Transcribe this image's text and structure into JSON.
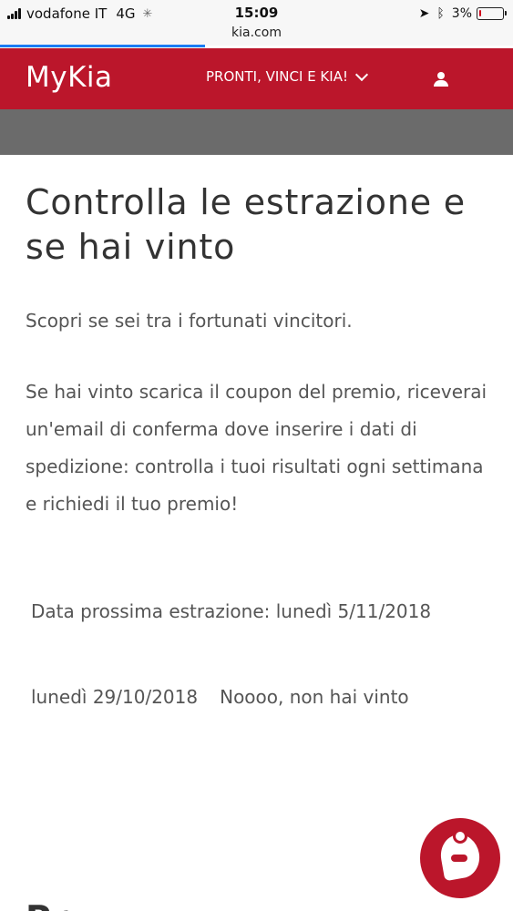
{
  "status_bar": {
    "carrier": "vodafone IT",
    "network": "4G",
    "time": "15:09",
    "battery": "3%",
    "battery_level": 0.03,
    "url": "kia.com",
    "page_load_progress": 0.4
  },
  "header": {
    "logo": "MyKia",
    "campaign_menu": "PRONTI, VINCI E KIA!",
    "icons": [
      "chevron-down-icon",
      "user-icon"
    ],
    "brand_color": "#bb162b"
  },
  "main": {
    "title": "Controlla le estrazione e se hai vinto",
    "intro": "Scopri se sei tra i fortunati vincitori.",
    "description": "Se hai vinto scarica il coupon del premio, riceverai un'email di conferma dove inserire i dati di spedizione: controlla i tuoi risultati ogni settimana e richiedi il tuo premio!",
    "next_draw": "Data prossima estrazione: lunedì 5/11/2018",
    "results": [
      {
        "date": "lunedì 29/10/2018",
        "outcome": "Noooo, non hai vinto"
      }
    ],
    "next_section_title": "Pr..."
  },
  "chat": {
    "icon": "chat-assistant-icon"
  }
}
